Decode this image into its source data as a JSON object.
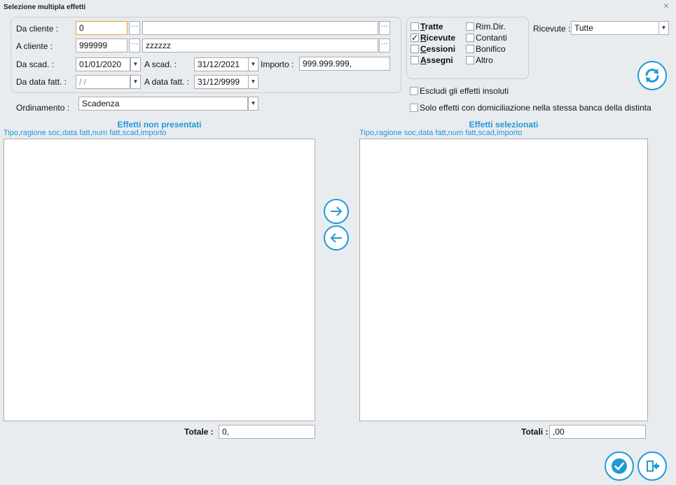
{
  "window": {
    "title": "Selezione multipla effetti",
    "close": "×"
  },
  "filters": {
    "da_cliente": {
      "label": "Da cliente :",
      "value": "0",
      "name_value": ""
    },
    "a_cliente": {
      "label": "A cliente :",
      "value": "999999",
      "name_value": "zzzzzz"
    },
    "da_scad": {
      "label": "Da scad. :",
      "value": "01/01/2020"
    },
    "a_scad": {
      "label": "A scad. :",
      "value": "31/12/2021"
    },
    "importo": {
      "label": "Importo :",
      "value": "999.999.999,"
    },
    "da_data_fatt": {
      "label": "Da data fatt. :",
      "value": " /  /"
    },
    "a_data_fatt": {
      "label": "A data fatt. :",
      "value": "31/12/9999"
    },
    "ordinamento": {
      "label": "Ordinamento :",
      "value": "Scadenza"
    },
    "dots": "···",
    "caret": "▼"
  },
  "types": {
    "left": [
      {
        "label": "Tratte",
        "checked": false
      },
      {
        "label": "Ricevute",
        "checked": true
      },
      {
        "label": "Cessioni",
        "checked": false
      },
      {
        "label": "Assegni",
        "checked": false
      }
    ],
    "right": [
      {
        "label": "Rim.Dir.",
        "checked": false
      },
      {
        "label": "Contanti",
        "checked": false
      },
      {
        "label": "Bonifico",
        "checked": false
      },
      {
        "label": "Altro",
        "checked": false
      }
    ],
    "check_mark": "✓"
  },
  "ricevute": {
    "label": "Ricevute :",
    "value": "Tutte"
  },
  "options": {
    "escludi_insoluti": {
      "label": "Escludi gli effetti insoluti",
      "checked": false
    },
    "solo_stessa_banca": {
      "label": "Solo effetti con domiciliazione nella stessa banca della distinta",
      "checked": false
    }
  },
  "left_list": {
    "title": "Effetti non presentati",
    "columns": "Tipo,ragione soc,data fatt,num fatt,scad,importo",
    "total_label": "Totale :",
    "total_value": "0,"
  },
  "right_list": {
    "title": "Effetti selezionati",
    "columns": "Tipo,ragione soc,data fatt,num fatt,scad,importo",
    "total_label": "Totali :",
    "total_value": ",00"
  },
  "colors": {
    "accent": "#1f9ad6",
    "focus_border": "#e8a33a",
    "background": "#e9ecef"
  }
}
